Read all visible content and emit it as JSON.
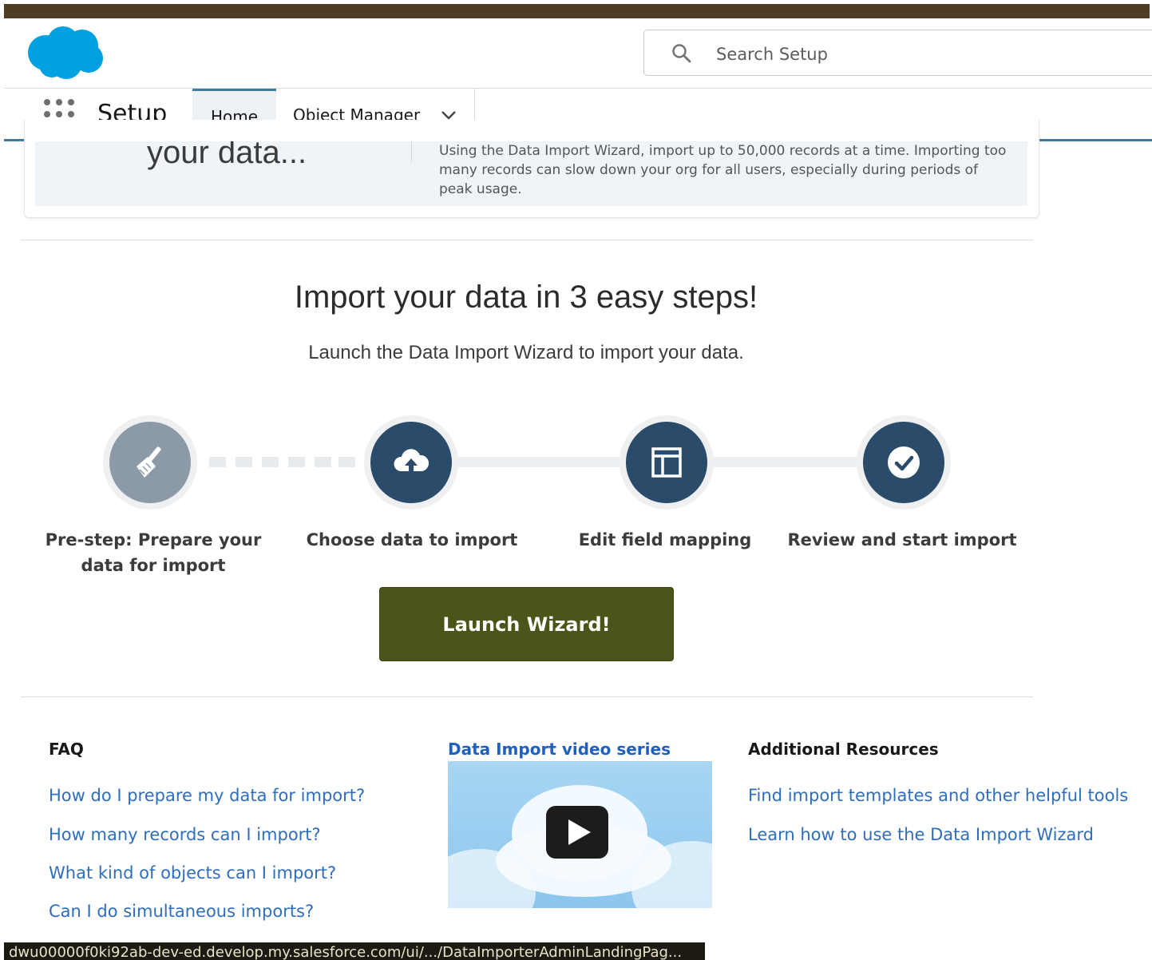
{
  "header": {
    "logo_icon": "salesforce-cloud-logo",
    "search_placeholder": "Search Setup"
  },
  "nav": {
    "app_name": "Setup",
    "tabs": [
      {
        "label": "Home",
        "active": true
      },
      {
        "label": "Object Manager",
        "has_dropdown": true
      }
    ]
  },
  "banner": {
    "title": "your data...",
    "text": "Using the Data Import Wizard, import up to 50,000 records at a time. Importing too many records can slow down your org for all users, especially during periods of peak usage."
  },
  "main": {
    "heading": "Import your data in 3 easy steps!",
    "subheading": "Launch the Data Import Wizard to import your data.",
    "steps": [
      {
        "label_line1": "Pre-step: Prepare your",
        "label_line2": "data for import",
        "icon": "broom-icon",
        "color": "#8c9aa8"
      },
      {
        "label_line1": "Choose data to import",
        "icon": "cloud-upload-icon",
        "color": "#2b4b6b"
      },
      {
        "label_line1": "Edit field mapping",
        "icon": "layout-icon",
        "color": "#2b4b6b"
      },
      {
        "label_line1": "Review and start import",
        "icon": "check-icon",
        "color": "#2b4b6b"
      }
    ],
    "launch_label": "Launch Wizard!",
    "launch_color": "#4a5519"
  },
  "faq": {
    "title": "FAQ",
    "links": [
      "How do I prepare my data for import?",
      "How many records can I import?",
      "What kind of objects can I import?",
      "Can I do simultaneous imports?"
    ]
  },
  "video": {
    "title": "Data Import video series",
    "icon": "play-icon"
  },
  "resources": {
    "title": "Additional Resources",
    "links": [
      "Find import templates and other helpful tools",
      "Learn how to use the Data Import Wizard"
    ]
  },
  "status_bar": {
    "url": "dwu00000f0ki92ab-dev-ed.develop.my.salesforce.com/ui/.../DataImporterAdminLandingPag..."
  },
  "colors": {
    "top_strip": "#4f3c24",
    "link": "#2f6dbd",
    "nav_accent": "#3f7ca0",
    "step_dark": "#2b4b6b"
  }
}
